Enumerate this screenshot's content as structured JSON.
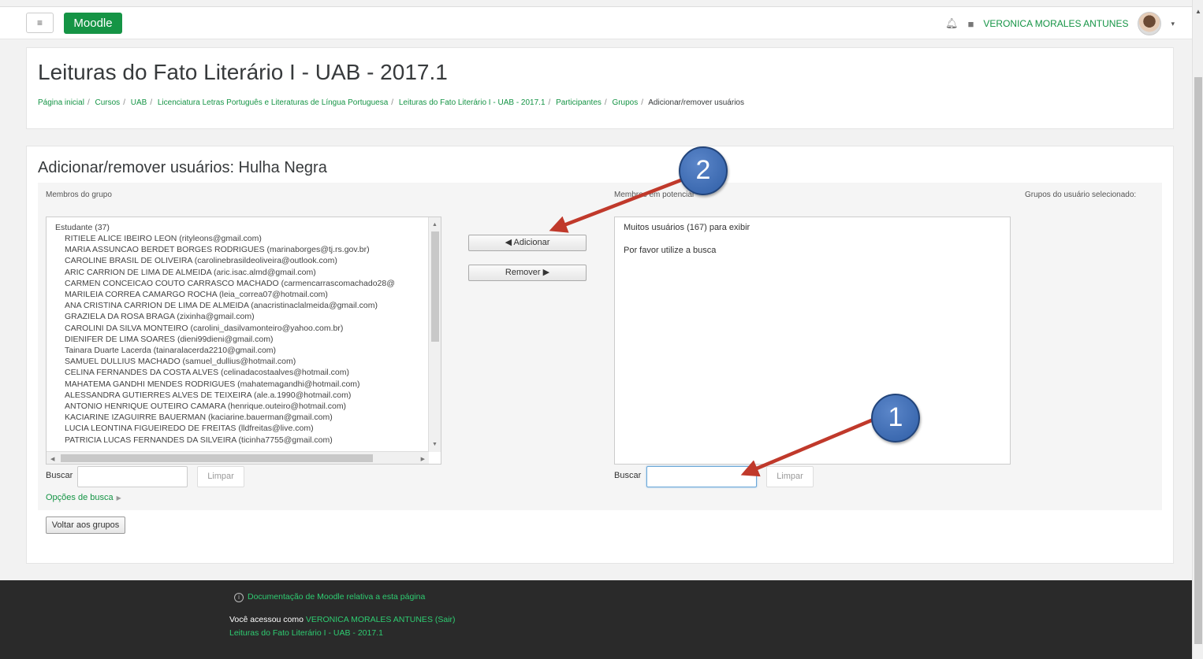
{
  "navbar": {
    "menu_icon": "hamburger-icon",
    "menu_glyph": "≡",
    "brand": "Moodle",
    "notification_icon": "bell-icon",
    "message_icon": "message-icon",
    "user_name": "VERONICA MORALES ANTUNES",
    "caret": "▾"
  },
  "header": {
    "title": "Leituras do Fato Literário I - UAB - 2017.1",
    "breadcrumb": [
      "Página inicial",
      "Cursos",
      "UAB",
      "Licenciatura Letras Português e Literaturas de Língua Portuguesa",
      "Leituras do Fato Literário I - UAB - 2017.1",
      "Participantes",
      "Grupos"
    ],
    "breadcrumb_separator": "/",
    "breadcrumb_current": "Adicionar/remover usuários"
  },
  "main": {
    "title": "Adicionar/remover usuários: Hulha Negra",
    "members_label": "Membros do grupo",
    "potential_label": "Membros em potencial",
    "user_groups_label": "Grupos do usuário selecionado:",
    "members_group": "Estudante (37)",
    "members": [
      "RITIELE ALICE IBEIRO LEON (rityleons@gmail.com)",
      "MARIA ASSUNCAO BERDET BORGES RODRIGUES (marinaborges@tj.rs.gov.br)",
      "CAROLINE BRASIL DE OLIVEIRA (carolinebrasildeoliveira@outlook.com)",
      "ARIC CARRION DE LIMA DE ALMEIDA (aric.isac.almd@gmail.com)",
      "CARMEN CONCEICAO COUTO CARRASCO MACHADO (carmencarrascomachado28@",
      "MARILEIA CORREA CAMARGO ROCHA (leia_correa07@hotmail.com)",
      "ANA CRISTINA CARRION DE LIMA DE ALMEIDA (anacristinaclalmeida@gmail.com)",
      "GRAZIELA DA ROSA BRAGA (zixinha@gmail.com)",
      "CAROLINI DA SILVA MONTEIRO (carolini_dasilvamonteiro@yahoo.com.br)",
      "DIENIFER DE LIMA SOARES (dieni99dieni@gmail.com)",
      "Tainara Duarte Lacerda (tainaralacerda2210@gmail.com)",
      "SAMUEL DULLIUS MACHADO (samuel_dullius@hotmail.com)",
      "CELINA FERNANDES DA COSTA ALVES (celinadacostaalves@hotmail.com)",
      "MAHATEMA GANDHI MENDES RODRIGUES (mahatemagandhi@hotmail.com)",
      "ALESSANDRA GUTIERRES ALVES DE TEIXEIRA (ale.a.1990@hotmail.com)",
      "ANTONIO HENRIQUE OUTEIRO CAMARA (henrique.outeiro@hotmail.com)",
      "KACIARINE IZAGUIRRE BAUERMAN (kaciarine.bauerman@gmail.com)",
      "LUCIA LEONTINA FIGUEIREDO DE FREITAS (lldfreitas@live.com)",
      "PATRICIA LUCAS FERNANDES DA SILVEIRA (ticinha7755@gmail.com)"
    ],
    "add_button": "◀ Adicionar",
    "remove_button": "Remover ▶",
    "potential_line1": "Muitos usuários (167) para exibir",
    "potential_line2": "Por favor utilize a busca",
    "search_label": "Buscar",
    "clear_label": "Limpar",
    "search_left_value": "",
    "search_right_value": "",
    "search_options": "Opções de busca",
    "back_button": "Voltar aos grupos"
  },
  "footer": {
    "doc_link": "Documentação de Moodle relativa a esta página",
    "logged_prefix": "Você acessou como",
    "logged_user": "VERONICA MORALES ANTUNES",
    "logout": "(Sair)",
    "course_link": "Leituras do Fato Literário I - UAB - 2017.1"
  },
  "annotations": {
    "callout_1": "1",
    "callout_2": "2",
    "arrow_color": "#c0392b"
  }
}
